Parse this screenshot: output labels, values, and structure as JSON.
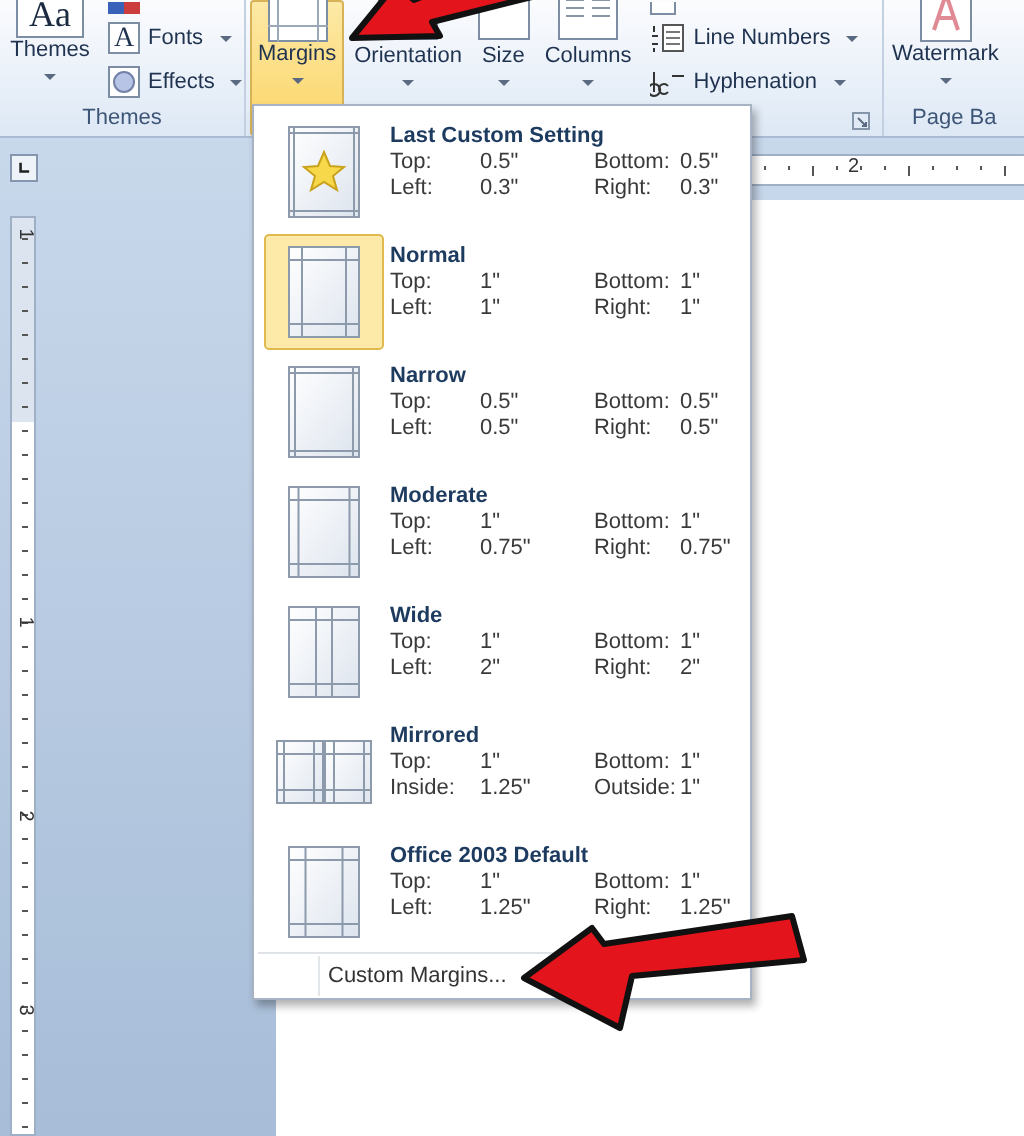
{
  "themes_group": {
    "label": "Themes",
    "themes_button": {
      "icon_text": "Aa",
      "label": "Themes"
    },
    "small_buttons": [
      {
        "kind": "letter",
        "icon_text": "A",
        "label": "Fonts"
      },
      {
        "kind": "circle",
        "label": "Effects"
      }
    ]
  },
  "page_setup_group": {
    "buttons": [
      {
        "label": "Margins",
        "selected": true
      },
      {
        "label": "Orientation",
        "selected": false
      },
      {
        "label": "Size",
        "selected": false
      },
      {
        "label": "Columns",
        "selected": false
      }
    ],
    "small_buttons": [
      {
        "kind": "line-numbers",
        "label": "Line Numbers"
      },
      {
        "kind": "hyphenation",
        "label": "Hyphenation"
      }
    ]
  },
  "page_background_group": {
    "label": "Page Ba",
    "buttons": [
      {
        "label": "Watermark"
      }
    ]
  },
  "horizontal_ruler": {
    "numbers": [
      "2"
    ]
  },
  "vertical_ruler": {
    "numbers": [
      "1",
      "1",
      "2",
      "3"
    ]
  },
  "margins_menu": {
    "items": [
      {
        "kind": "custom",
        "title": "Last Custom Setting",
        "selected": false,
        "rows": [
          [
            "Top:",
            "0.5\"",
            "Bottom:",
            "0.5\""
          ],
          [
            "Left:",
            "0.3\"",
            "Right:",
            "0.3\""
          ]
        ]
      },
      {
        "kind": "page",
        "title": "Normal",
        "selected": true,
        "rows": [
          [
            "Top:",
            "1\"",
            "Bottom:",
            "1\""
          ],
          [
            "Left:",
            "1\"",
            "Right:",
            "1\""
          ]
        ]
      },
      {
        "kind": "page",
        "title": "Narrow",
        "selected": false,
        "rows": [
          [
            "Top:",
            "0.5\"",
            "Bottom:",
            "0.5\""
          ],
          [
            "Left:",
            "0.5\"",
            "Right:",
            "0.5\""
          ]
        ]
      },
      {
        "kind": "page",
        "title": "Moderate",
        "selected": false,
        "rows": [
          [
            "Top:",
            "1\"",
            "Bottom:",
            "1\""
          ],
          [
            "Left:",
            "0.75\"",
            "Right:",
            "0.75\""
          ]
        ]
      },
      {
        "kind": "page",
        "title": "Wide",
        "selected": false,
        "rows": [
          [
            "Top:",
            "1\"",
            "Bottom:",
            "1\""
          ],
          [
            "Left:",
            "2\"",
            "Right:",
            "2\""
          ]
        ]
      },
      {
        "kind": "mirrored",
        "title": "Mirrored",
        "selected": false,
        "rows": [
          [
            "Top:",
            "1\"",
            "Bottom:",
            "1\""
          ],
          [
            "Inside:",
            "1.25\"",
            "Outside:",
            "1\""
          ]
        ]
      },
      {
        "kind": "page",
        "title": "Office 2003 Default",
        "selected": false,
        "rows": [
          [
            "Top:",
            "1\"",
            "Bottom:",
            "1\""
          ],
          [
            "Left:",
            "1.25\"",
            "Right:",
            "1.25\""
          ]
        ]
      }
    ],
    "footer": "Custom Margins..."
  }
}
